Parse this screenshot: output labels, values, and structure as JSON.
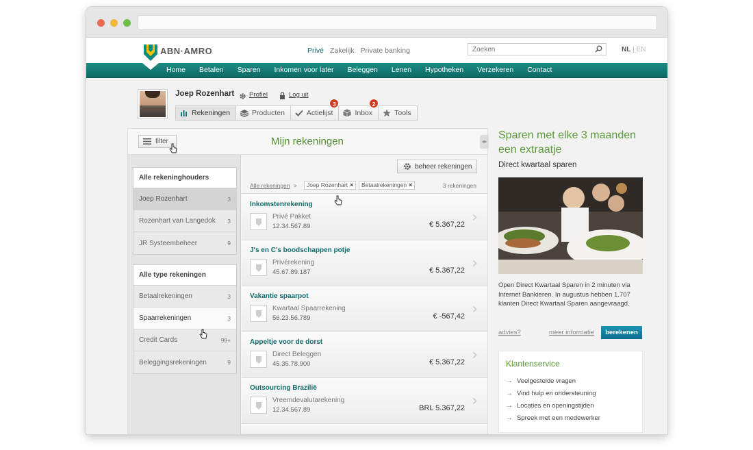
{
  "top_segments": [
    "Privé",
    "Zakelijk",
    "Private banking"
  ],
  "brand": {
    "name": "ABN·AMRO",
    "accent": "#0d6a65",
    "green": "#5a9a3a"
  },
  "search": {
    "placeholder": "Zoeken"
  },
  "lang": {
    "active": "NL",
    "sep": "|",
    "other": "EN"
  },
  "nav": [
    "Home",
    "Betalen",
    "Sparen",
    "Inkomen voor later",
    "Beleggen",
    "Lenen",
    "Hypotheken",
    "Verzekeren",
    "Contact"
  ],
  "user": {
    "name": "Joep Rozenhart",
    "profile_label": "Profiel",
    "logout_label": "Log uit"
  },
  "tabs": [
    {
      "label": "Rekeningen",
      "icon": "bar-chart-icon",
      "badge": ""
    },
    {
      "label": "Producten",
      "icon": "layers-icon",
      "badge": ""
    },
    {
      "label": "Actielijst",
      "icon": "checkmark-icon",
      "badge": "3"
    },
    {
      "label": "Inbox",
      "icon": "box-icon",
      "badge": "2"
    },
    {
      "label": "Tools",
      "icon": "star-icon",
      "badge": ""
    }
  ],
  "panel": {
    "filter_label": "filter",
    "title": "Mijn rekeningen"
  },
  "filters": {
    "holders_title": "Alle rekeninghouders",
    "holders": [
      {
        "label": "Joep Rozenhart",
        "count": "3"
      },
      {
        "label": "Rozenhart van Langedok",
        "count": "3"
      },
      {
        "label": "JR Systeembeheer",
        "count": "9"
      }
    ],
    "types_title": "Alle type rekeningen",
    "types": [
      {
        "label": "Betaalrekeningen",
        "count": "3"
      },
      {
        "label": "Spaarrekeningen",
        "count": "3"
      },
      {
        "label": "Credit Cards",
        "count": "99+"
      },
      {
        "label": "Beleggingsrekeningen",
        "count": "9"
      }
    ]
  },
  "toolbar": {
    "beheer_label": "beheer rekeningen"
  },
  "crumbs": {
    "root": "Alle rekeningen",
    "sep": ">",
    "chip1": "Joep Rozenhart",
    "chip2": "Betaalrekeningen",
    "remove": "×",
    "count": "3 rekeningen"
  },
  "accounts": [
    {
      "name": "Inkomstenrekening",
      "type": "Privé Pakket",
      "number": "12.34.567.89",
      "amount": "€ 5.367,22"
    },
    {
      "name": "J's en C's boodschappen potje",
      "type": "Privérekening",
      "number": "45.67.89.187",
      "amount": "€ 5.367,22"
    },
    {
      "name": "Vakantie spaarpot",
      "type": "Kwartaal Spaarrekening",
      "number": "56.23.56.789",
      "amount": "€ -567,42"
    },
    {
      "name": "Appeltje voor de dorst",
      "type": "Direct Beleggen",
      "number": "45.35.78.900",
      "amount": "€ 5.367,22"
    },
    {
      "name": "Outsourcing Brazilië",
      "type": "Vreemdevalutarekening",
      "number": "12.34.567.89",
      "amount": "BRL 5.367,22"
    }
  ],
  "promo": {
    "title": "Sparen met elke 3 maanden een extraatje",
    "subtitle": "Direct kwartaal sparen",
    "text": "Open Direct Kwartaal Sparen in 2 minuten via Internet Bankieren. In augustus hebben 1.707 klanten Direct Kwartaal Sparen aangevraagd.",
    "link1": "advies?",
    "link2": "meer informatie",
    "button": "berekenen"
  },
  "service": {
    "title": "Klantenservice",
    "arrow": "→",
    "items": [
      "Veelgestelde vragen",
      "Vind hulp en ondersteuning",
      "Locaties en openingstijden",
      "Spreek met een medewerker"
    ]
  }
}
